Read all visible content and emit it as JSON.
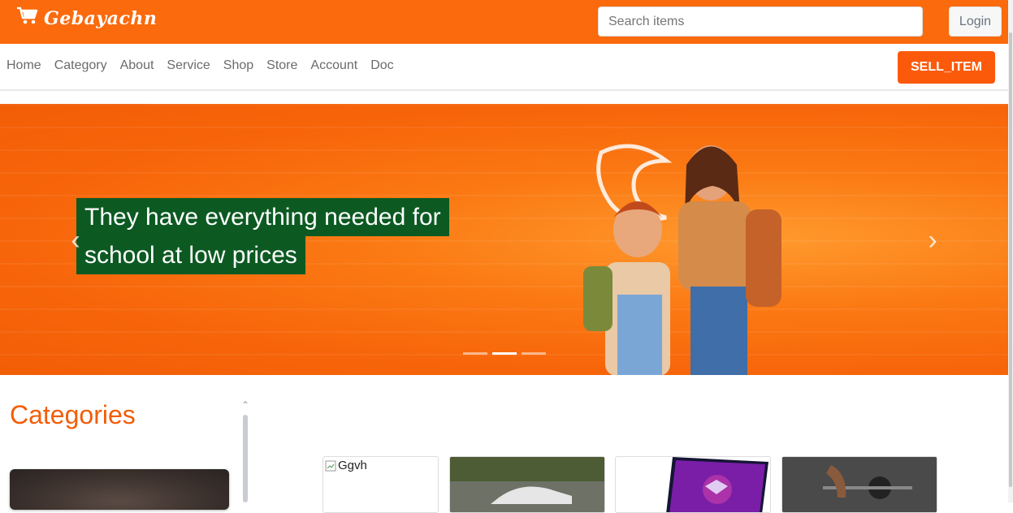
{
  "brand": {
    "name": "Gebayachn",
    "icon": "cart-icon"
  },
  "search": {
    "placeholder": "Search items",
    "value": ""
  },
  "header": {
    "login_label": "Login"
  },
  "nav": {
    "items": [
      "Home",
      "Category",
      "About",
      "Service",
      "Shop",
      "Store",
      "Account",
      "Doc"
    ],
    "sell_label": "SELL_ITEM"
  },
  "carousel": {
    "caption_line1": "They have everything needed for",
    "caption_line2": "school at low prices",
    "slide_count": 3,
    "active_slide": 2,
    "prev_icon": "chevron-left-icon",
    "next_icon": "chevron-right-icon"
  },
  "categories": {
    "title": "Categories"
  },
  "products": [
    {
      "alt": "Ggvh",
      "image": "broken-image"
    },
    {
      "image": "car-photo"
    },
    {
      "image": "laptop-photo"
    },
    {
      "image": "gym-photo"
    }
  ],
  "colors": {
    "accent": "#fb6a0c",
    "caption_bg": "#0c5a22",
    "title": "#f25d06"
  }
}
